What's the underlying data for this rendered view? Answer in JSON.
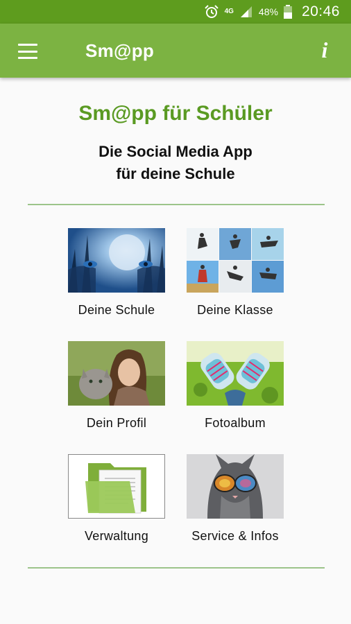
{
  "status_bar": {
    "network": "4G",
    "battery": "48%",
    "time": "20:46",
    "icons": [
      "alarm-icon",
      "network-4g-icon",
      "signal-icon",
      "battery-icon"
    ]
  },
  "app_bar": {
    "title": "Sm@pp",
    "menu_icon": "hamburger-menu-icon",
    "info_icon": "info-icon",
    "info_glyph": "i"
  },
  "main": {
    "headline": "Sm@pp für Schüler",
    "subline_1": "Die Social Media App",
    "subline_2": "für deine Schule"
  },
  "tiles": [
    {
      "label": "Deine Schule"
    },
    {
      "label": "Deine Klasse"
    },
    {
      "label": "Dein Profil"
    },
    {
      "label": "Fotoalbum"
    },
    {
      "label": "Verwaltung"
    },
    {
      "label": "Service & Infos"
    }
  ],
  "colors": {
    "status_bar": "#5e9c1e",
    "app_bar": "#7cb342",
    "headline": "#5a9a22",
    "divider": "#9cc48a"
  }
}
